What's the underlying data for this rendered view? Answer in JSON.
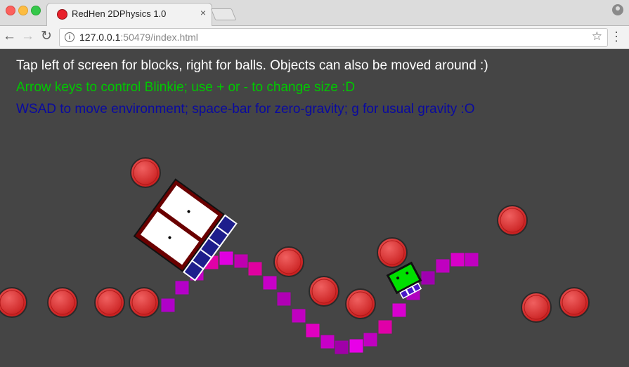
{
  "browser": {
    "tab_title": "RedHen 2DPhysics 1.0",
    "tab_close": "×",
    "url_host": "127.0.0.1",
    "url_port_path": ":50479/index.html",
    "icons": [
      "back-icon",
      "forward-icon",
      "reload-icon",
      "info-icon",
      "bookmark-star-icon",
      "menu-icon",
      "profile-icon"
    ]
  },
  "game": {
    "instructions": [
      "Tap left of screen for blocks, right for balls. Objects can also be moved around :)",
      "Arrow keys to control Blinkie; use + or - to change size :D",
      "WSAD to move environment; space-bar for zero-gravity; g for usual gravity :O"
    ],
    "colors": {
      "background": "#454545",
      "instruction_1": "#ffffff",
      "instruction_2": "#00c800",
      "instruction_3": "#0a0aa0",
      "ball": "#e83838",
      "blinkie": "#00e000",
      "block_frame": "#6a0000"
    }
  }
}
